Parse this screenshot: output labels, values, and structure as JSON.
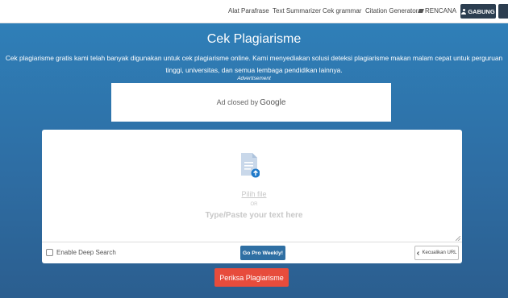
{
  "nav": {
    "items": [
      "Alat Parafrase",
      "Text Summarizer",
      "Cek grammar",
      "Citation Generator",
      "RENCANA"
    ],
    "join_label": "GABUNG"
  },
  "hero": {
    "title": "Cek Plagiarisme",
    "description": "Cek plagiarisme gratis kami telah banyak digunakan untuk cek plagiarisme online. Kami menyediakan solusi deteksi plagiarisme makan malam cepat untuk perguruan tinggi, universitas, dan semua lembaga pendidikan lainnya.",
    "ad_label": "Advertisement"
  },
  "ad": {
    "closed_text": "Ad closed by",
    "brand": "Google"
  },
  "editor": {
    "pick_file": "Pilih file",
    "or": "OR",
    "placeholder": "Type/Paste your text here",
    "deep_search_label": "Enable Deep Search",
    "deep_search_checked": false,
    "pro_button": "Go Pro Weekly!",
    "exclude_url_button": "Kecualikan URL"
  },
  "submit_button": "Periksa Plagiarisme",
  "colors": {
    "brand": "#2f6fa3",
    "dark_button": "#2c3e50",
    "submit": "#e74c3c",
    "upload_icon": "#1f79c9"
  }
}
